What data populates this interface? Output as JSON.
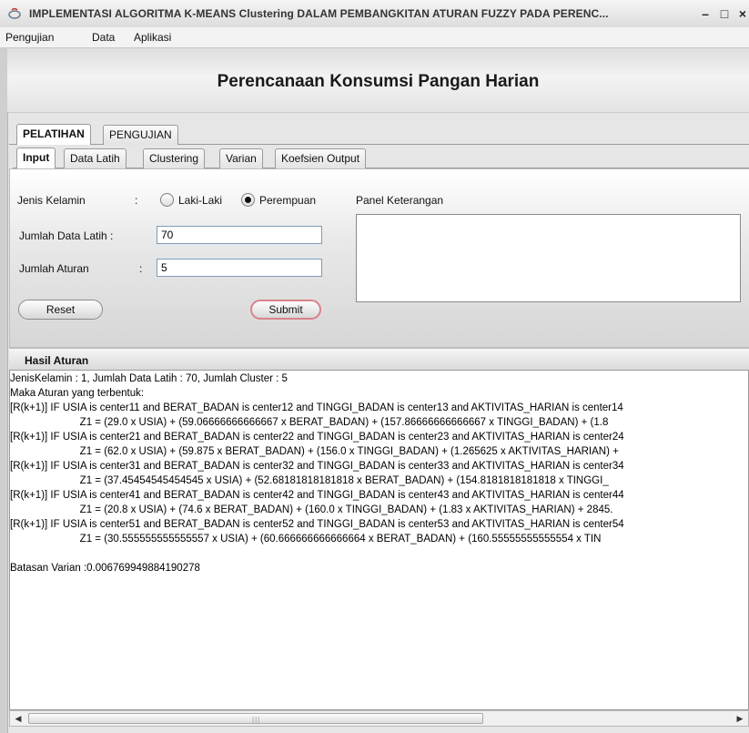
{
  "window": {
    "title": "IMPLEMENTASI ALGORITMA K-MEANS Clustering DALAM PEMBANGKITAN ATURAN FUZZY PADA PERENC...",
    "minimize": "–",
    "maximize": "□",
    "close": "×"
  },
  "menu": [
    "Pengujian",
    "Data",
    "Aplikasi"
  ],
  "header": {
    "title": "Perencanaan Konsumsi Pangan Harian"
  },
  "main_tabs": [
    "PELATIHAN",
    "PENGUJIAN"
  ],
  "sub_tabs": [
    "Input",
    "Data Latih",
    "Clustering",
    "Varian",
    "Koefsien Output"
  ],
  "form": {
    "gender_label": "Jenis Kelamin",
    "colon": ":",
    "option_male": "Laki-Laki",
    "option_female": "Perempuan",
    "selected_gender": "Perempuan",
    "jumlah_data_label": "Jumlah Data Latih :",
    "jumlah_data_value": "70",
    "jumlah_aturan_label": "Jumlah Aturan",
    "jumlah_aturan_value": "5",
    "reset_label": "Reset",
    "submit_label": "Submit",
    "panel_label": "Panel Keterangan"
  },
  "result": {
    "heading": "Hasil Aturan",
    "lines": [
      "JenisKelamin : 1, Jumlah Data Latih : 70, Jumlah Cluster : 5",
      "Maka Aturan yang terbentuk:",
      "[R(k+1)] IF USIA is center11 and BERAT_BADAN is center12 and TINGGI_BADAN is center13 and AKTIVITAS_HARIAN is center14",
      "                        Z1 = (29.0 x USIA) + (59.06666666666667 x BERAT_BADAN) + (157.86666666666667 x TINGGI_BADAN) + (1.8",
      "[R(k+1)] IF USIA is center21 and BERAT_BADAN is center22 and TINGGI_BADAN is center23 and AKTIVITAS_HARIAN is center24",
      "                        Z1 = (62.0 x USIA) + (59.875 x BERAT_BADAN) + (156.0 x TINGGI_BADAN) + (1.265625 x AKTIVITAS_HARIAN) +",
      "[R(k+1)] IF USIA is center31 and BERAT_BADAN is center32 and TINGGI_BADAN is center33 and AKTIVITAS_HARIAN is center34",
      "                        Z1 = (37.45454545454545 x USIA) + (52.68181818181818 x BERAT_BADAN) + (154.8181818181818 x TINGGI_",
      "[R(k+1)] IF USIA is center41 and BERAT_BADAN is center42 and TINGGI_BADAN is center43 and AKTIVITAS_HARIAN is center44",
      "                        Z1 = (20.8 x USIA) + (74.6 x BERAT_BADAN) + (160.0 x TINGGI_BADAN) + (1.83 x AKTIVITAS_HARIAN) + 2845.",
      "[R(k+1)] IF USIA is center51 and BERAT_BADAN is center52 and TINGGI_BADAN is center53 and AKTIVITAS_HARIAN is center54",
      "                        Z1 = (30.555555555555557 x USIA) + (60.666666666666664 x BERAT_BADAN) + (160.55555555555554 x TIN",
      "",
      "Batasan Varian :0.006769949884190278"
    ]
  },
  "scrollbar": {
    "left_arrow": "◀",
    "right_arrow": "▶",
    "grip": "|||"
  }
}
